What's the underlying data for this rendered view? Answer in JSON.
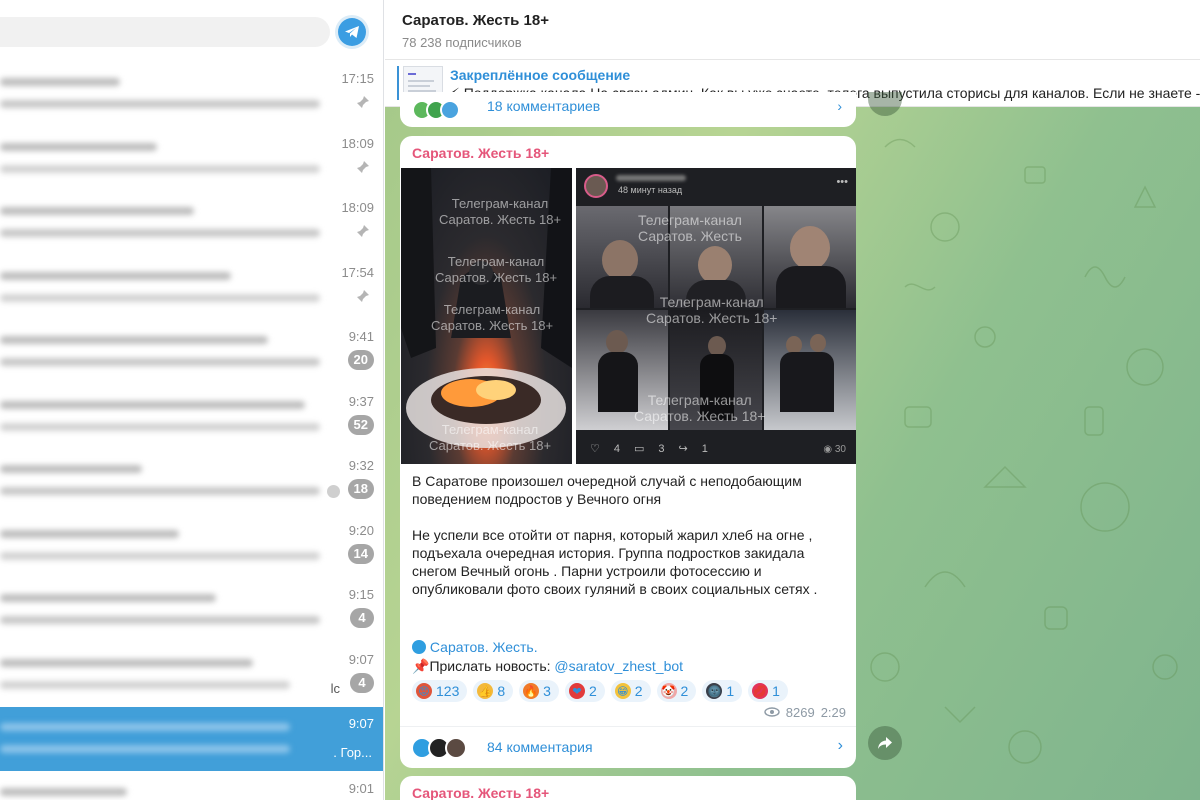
{
  "header": {
    "channel_title": "Саратов. Жесть 18+",
    "subscribers": "78 238 подписчиков"
  },
  "pinned": {
    "title": "Закреплённое сообщение",
    "text": "⚡ Поддержка канала  На связи админ. Как вы уже знаете, телега выпустила сторисы для каналов. Если не знаете -"
  },
  "sidebar": {
    "chats": [
      {
        "time": "17:15",
        "pinned": true
      },
      {
        "time": "18:09",
        "pinned": true
      },
      {
        "time": "18:09",
        "pinned": true
      },
      {
        "time": "17:54",
        "pinned": true
      },
      {
        "time": "9:41",
        "badge": "20"
      },
      {
        "time": "9:37",
        "badge": "52"
      },
      {
        "time": "9:32",
        "badge": "18"
      },
      {
        "time": "9:20",
        "badge": "14"
      },
      {
        "time": "9:15",
        "badge": "4"
      },
      {
        "time": "9:07",
        "badge": "4",
        "snippet_end": "lc"
      },
      {
        "time": "9:07",
        "active": true,
        "snippet_end": ". Гор..."
      },
      {
        "time": "9:01"
      }
    ]
  },
  "previous_post": {
    "comments_label": "18 комментариев"
  },
  "post": {
    "author": "Саратов. Жесть 18+",
    "watermark_left": [
      "Телеграм-канал",
      "Саратов. Жесть 18+"
    ],
    "watermark_right": [
      "Телеграм-канал",
      "Саратов. Жесть",
      "Телеграм-канал",
      "Саратов. Жесть 18+"
    ],
    "story": {
      "time_ago": "48 минут назад",
      "likes": "4",
      "comments": "3",
      "shares": "1",
      "views": "30"
    },
    "paragraph1": "В Саратове произошел очередной случай с неподобающим поведением подростов у Вечного огня",
    "paragraph2": "Не успели все отойти от парня, который жарил хлеб на огне , подъехала очередная история. Группа подростков закидала снегом Вечный огонь . Парни устроили фотосессию и опубликовали фото своих гуляний в своих социальных сетях .",
    "signature_channel": "Саратов. Жесть.",
    "signature_prefix": "Прислать новость: ",
    "signature_bot": "@saratov_zhest_bot",
    "reactions": [
      {
        "emoji": "angry-face",
        "glyph": "😡",
        "count": "123",
        "color": "#e0553a"
      },
      {
        "emoji": "thumbs-up",
        "glyph": "👍",
        "count": "8",
        "color": "#f3b93c"
      },
      {
        "emoji": "fire",
        "glyph": "🔥",
        "count": "3",
        "color": "#f07a2a"
      },
      {
        "emoji": "heart",
        "glyph": "❤",
        "count": "2",
        "color": "#e23b3b"
      },
      {
        "emoji": "grin-face",
        "glyph": "😁",
        "count": "2",
        "color": "#f3c23c"
      },
      {
        "emoji": "clown-face",
        "glyph": "🤡",
        "count": "2",
        "color": "#f0a6a6"
      },
      {
        "emoji": "new-moon-face",
        "glyph": "🌚",
        "count": "1",
        "color": "#3a3f4a"
      },
      {
        "emoji": "kiss-lips",
        "glyph": "💋",
        "count": "1",
        "color": "#e2345a"
      }
    ],
    "views": "8269",
    "time": "2:29",
    "comments_label": "84 комментария"
  },
  "next_post": {
    "author": "Саратов. Жесть 18+"
  },
  "colors": {
    "accent": "#2f8fd8",
    "author": "#e5567a",
    "active_chat": "#419fd9"
  }
}
